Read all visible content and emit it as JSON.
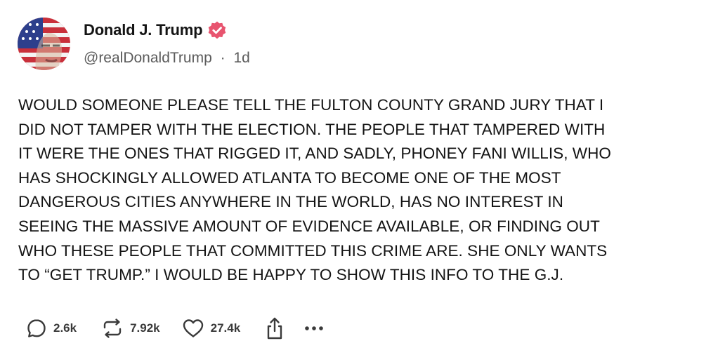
{
  "author": {
    "name": "Donald J. Trump",
    "handle": "@realDonaldTrump",
    "separator": "·",
    "time": "1d",
    "verified_color": "#e8546f"
  },
  "post": {
    "lines": [
      "WOULD SOMEONE PLEASE TELL THE FULTON COUNTY GRAND JURY THAT I",
      "DID NOT TAMPER WITH THE ELECTION. THE PEOPLE THAT TAMPERED WITH",
      "IT WERE THE ONES THAT RIGGED IT, AND SADLY, PHONEY FANI WILLIS, WHO",
      "HAS SHOCKINGLY ALLOWED ATLANTA TO BECOME ONE OF THE MOST",
      "DANGEROUS CITIES ANYWHERE IN THE WORLD, HAS NO INTEREST IN",
      "SEEING THE MASSIVE AMOUNT OF EVIDENCE AVAILABLE, OR FINDING OUT",
      "WHO THESE PEOPLE THAT COMMITTED THIS CRIME ARE. SHE ONLY WANTS",
      "TO “GET TRUMP.” I WOULD BE HAPPY TO SHOW THIS INFO TO THE G.J."
    ]
  },
  "actions": {
    "reply": {
      "icon": "reply-icon",
      "count": "2.6k"
    },
    "retruth": {
      "icon": "retruth-icon",
      "count": "7.92k"
    },
    "like": {
      "icon": "heart-icon",
      "count": "27.4k"
    },
    "share": {
      "icon": "share-icon"
    },
    "more": {
      "icon": "more-icon"
    }
  }
}
